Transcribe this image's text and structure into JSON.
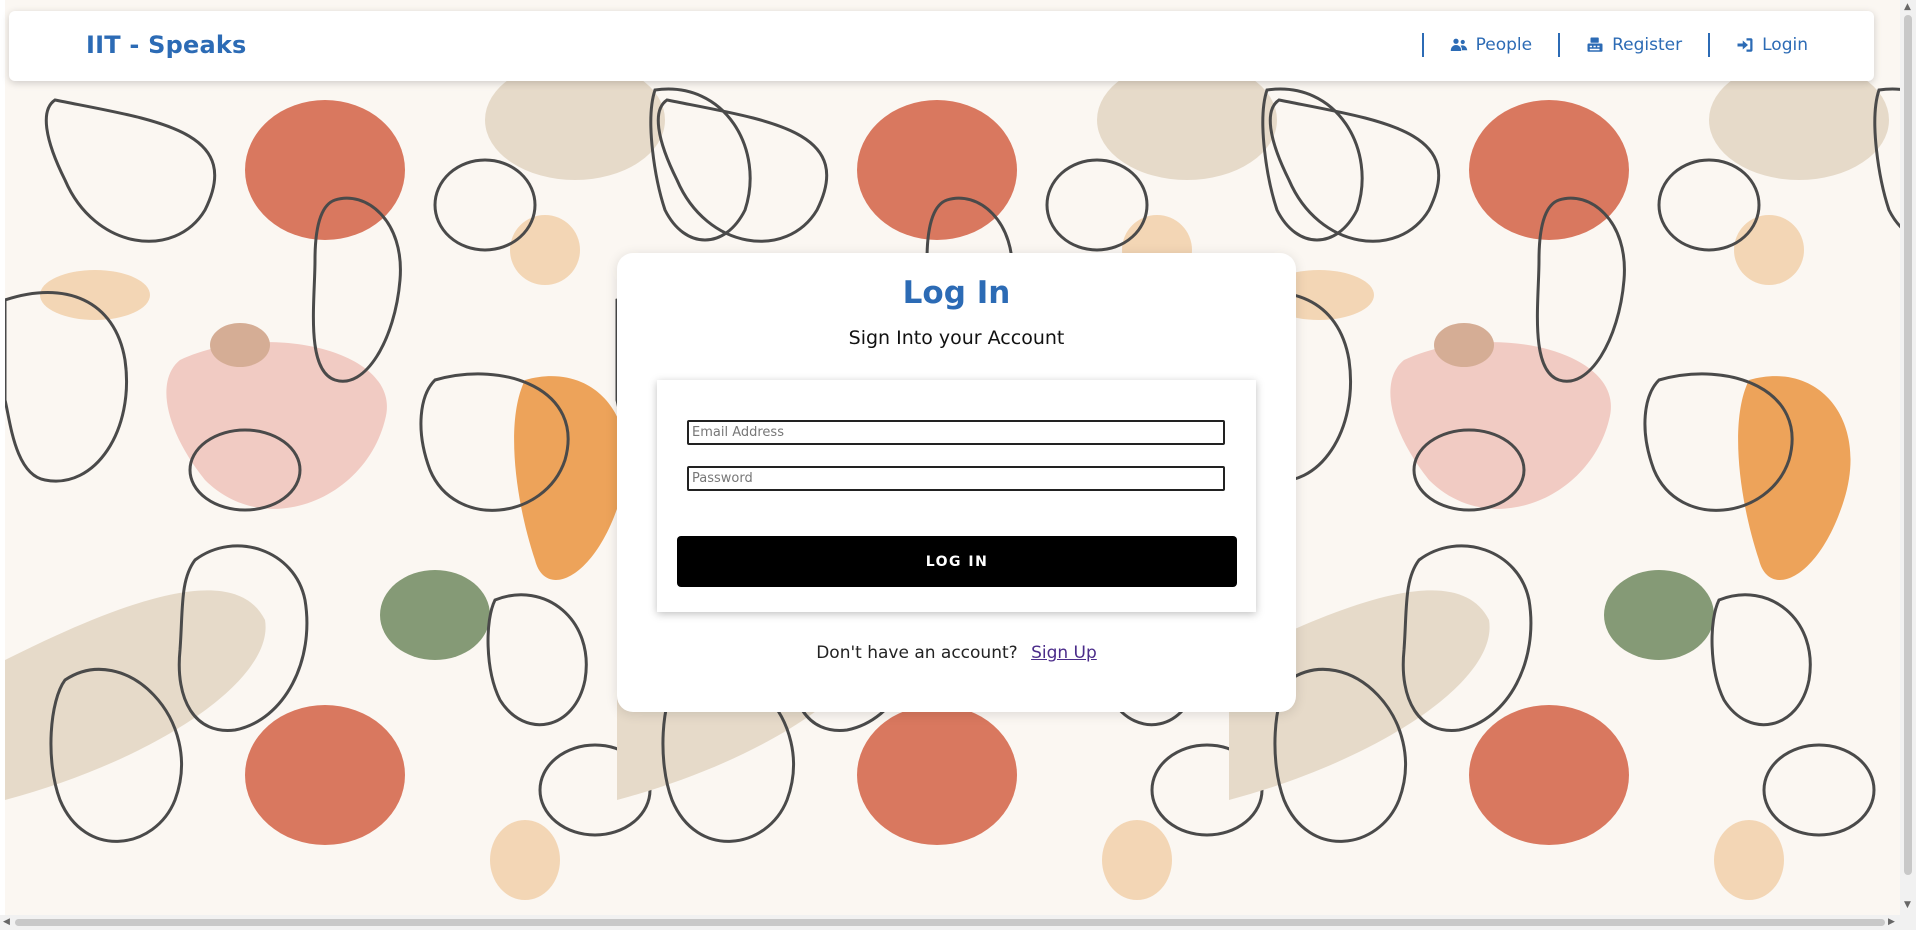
{
  "header": {
    "brand": "IIT - Speaks",
    "nav": [
      {
        "label": "People",
        "icon": "people-icon"
      },
      {
        "label": "Register",
        "icon": "register-icon"
      },
      {
        "label": "Login",
        "icon": "login-icon"
      }
    ]
  },
  "login": {
    "title": "Log In",
    "subtitle": "Sign Into your Account",
    "email_placeholder": "Email Address",
    "password_placeholder": "Password",
    "button_label": "LOG IN",
    "footer_text": "Don't have an account?",
    "signup_label": "Sign Up"
  },
  "colors": {
    "brand": "#2c6bb5",
    "button": "#000000",
    "terracotta": "#d9785f",
    "orange": "#eda35a",
    "pink": "#f1cbc3",
    "sage": "#859a76",
    "beige": "#e6dac9"
  }
}
